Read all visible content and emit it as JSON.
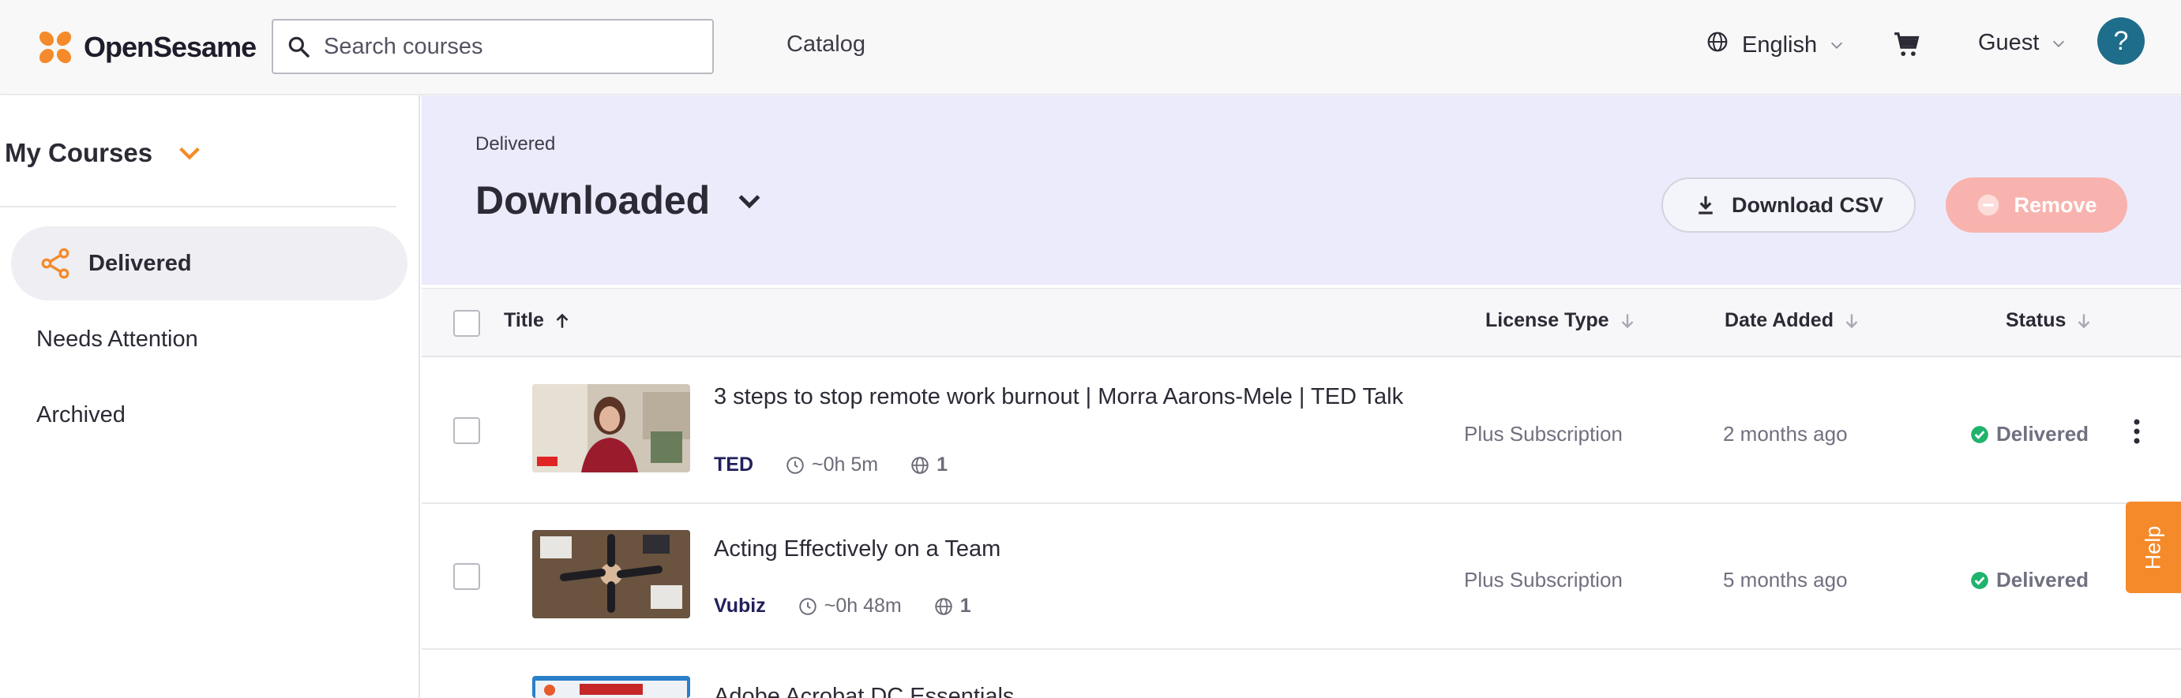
{
  "header": {
    "brand": "OpenSesame",
    "search_placeholder": "Search courses",
    "catalog": "Catalog",
    "language": "English",
    "user": "Guest",
    "help_symbol": "?"
  },
  "sidebar": {
    "title": "My Courses",
    "items": [
      {
        "label": "Delivered",
        "active": true,
        "icon": "share-icon"
      },
      {
        "label": "Needs Attention",
        "active": false
      },
      {
        "label": "Archived",
        "active": false
      }
    ]
  },
  "view": {
    "breadcrumb": "Delivered",
    "title": "Downloaded",
    "download_csv": "Download CSV",
    "remove": "Remove"
  },
  "table": {
    "columns": {
      "title": "Title",
      "license": "License Type",
      "date": "Date Added",
      "status": "Status"
    },
    "rows": [
      {
        "title": "3 steps to stop remote work burnout | Morra Aarons-Mele | TED Talk",
        "provider": "TED",
        "duration": "~0h 5m",
        "languages": "1",
        "license": "Plus Subscription",
        "date_added": "2 months ago",
        "status": "Delivered"
      },
      {
        "title": "Acting Effectively on a Team",
        "provider": "Vubiz",
        "duration": "~0h 48m",
        "languages": "1",
        "license": "Plus Subscription",
        "date_added": "5 months ago",
        "status": "Delivered"
      },
      {
        "title": "Adobe Acrobat DC Essentials"
      }
    ]
  },
  "help_tab": "Help",
  "colors": {
    "brand_orange": "#f58a2a",
    "status_green": "#1fb36b",
    "header_band": "#ecebfb",
    "remove_disabled": "#f8b3ae",
    "help_circle": "#1e6d8b"
  }
}
